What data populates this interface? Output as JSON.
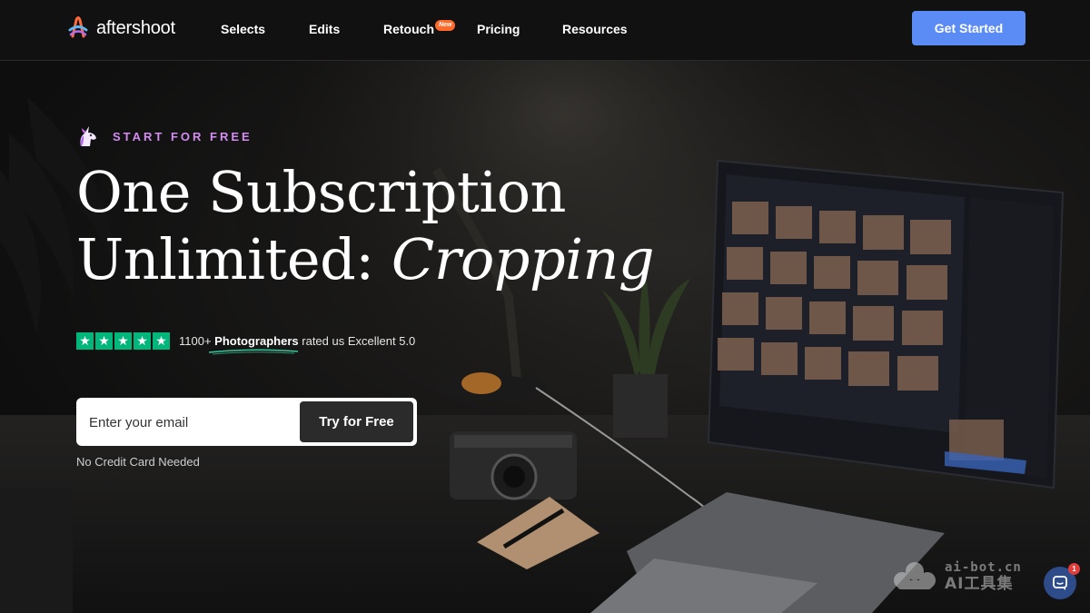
{
  "header": {
    "logo_text": "aftershoot",
    "nav": [
      {
        "label": "Selects"
      },
      {
        "label": "Edits"
      },
      {
        "label": "Retouch",
        "badge": "New"
      },
      {
        "label": "Pricing"
      },
      {
        "label": "Resources"
      }
    ],
    "cta_label": "Get Started",
    "cta_color": "#5b8cf5"
  },
  "hero": {
    "kicker": "START FOR FREE",
    "kicker_icon": "unicorn-icon",
    "headline_line1": "One Subscription",
    "headline_line2_prefix": "Unlimited:",
    "headline_line2_accent": "Cropping",
    "rating": {
      "stars": 5,
      "count": "1100+",
      "highlight": "Photographers",
      "suffix": "rated us Excellent 5.0",
      "star_color": "#00b67a"
    },
    "email_placeholder": "Enter your email",
    "submit_label": "Try for Free",
    "note": "No Credit Card Needed"
  },
  "overlay": {
    "watermark_url": "ai-bot.cn",
    "watermark_name": "AI工具集",
    "chat_unread": "1"
  },
  "colors": {
    "accent_purple": "#d38cf0",
    "background": "#0c0c0d"
  }
}
